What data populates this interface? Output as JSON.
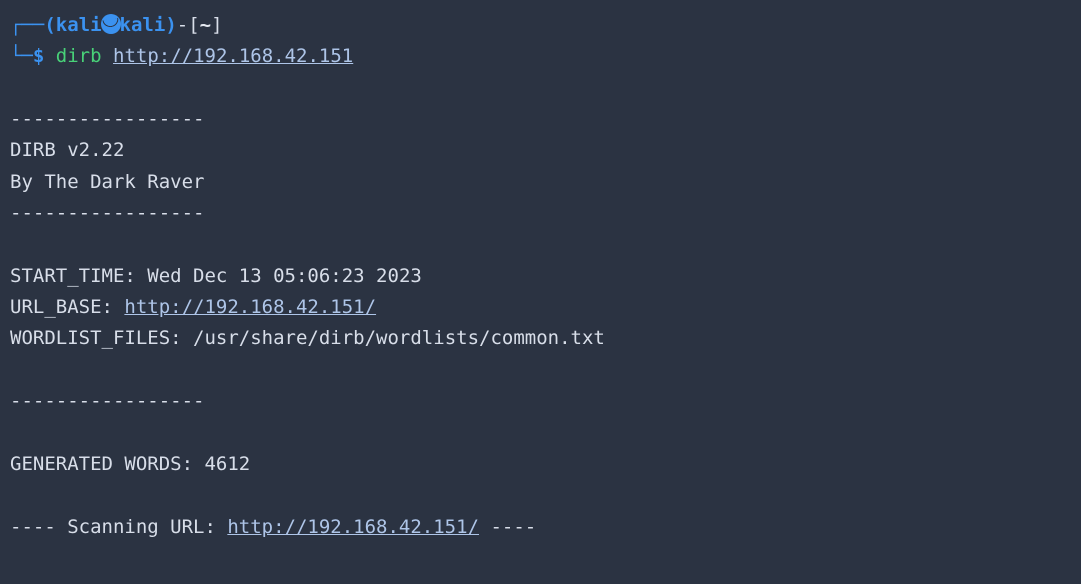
{
  "prompt": {
    "corner_top": "┌──",
    "paren_open": "(",
    "user": "kali",
    "host": "kali",
    "paren_close": ")",
    "dash": "-",
    "bracket_open": "[",
    "cwd": "~",
    "bracket_close": "]",
    "corner_bottom": "└─",
    "symbol": "$",
    "command": "dirb",
    "arg_url": "http://192.168.42.151"
  },
  "output": {
    "blank1": "",
    "divider1": "-----------------",
    "version": "DIRB v2.22",
    "byline": "By The Dark Raver",
    "divider2": "-----------------",
    "blank2": "",
    "start_time_label": "START_TIME: ",
    "start_time_value": "Wed Dec 13 05:06:23 2023",
    "url_base_label": "URL_BASE: ",
    "url_base_value": "http://192.168.42.151/",
    "wordlist_label": "WORDLIST_FILES: ",
    "wordlist_value": "/usr/share/dirb/wordlists/common.txt",
    "blank3": "",
    "divider3": "-----------------",
    "blank4": "",
    "generated_words": "GENERATED WORDS: 4612",
    "blank5": "",
    "scanning_prefix": "---- Scanning URL: ",
    "scanning_url": "http://192.168.42.151/",
    "scanning_suffix": " ----"
  }
}
